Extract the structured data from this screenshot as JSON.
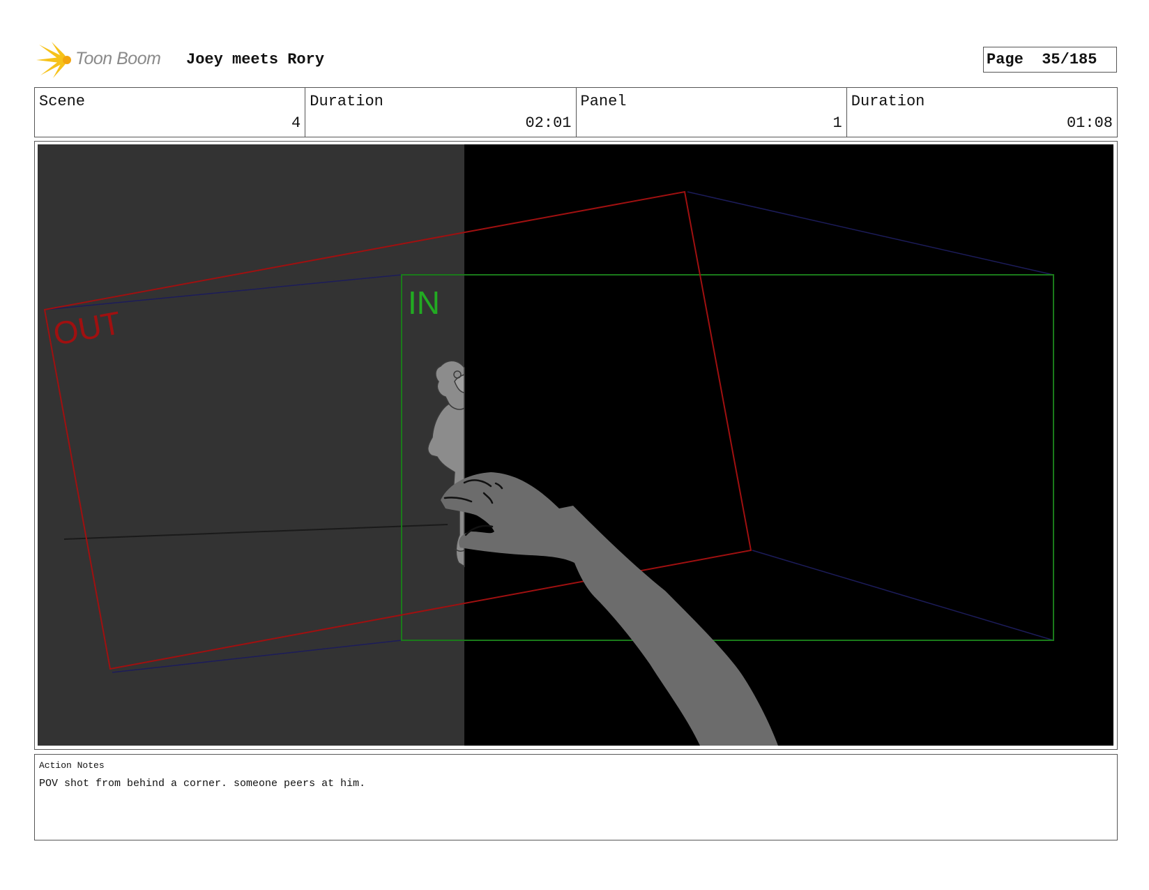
{
  "header": {
    "logo_text": "Toon Boom",
    "project_title": "Joey meets Rory",
    "page_label": "Page",
    "page_number": "35/185"
  },
  "info": [
    {
      "label": "Scene",
      "value": "4"
    },
    {
      "label": "Duration",
      "value": "02:01"
    },
    {
      "label": "Panel",
      "value": "1"
    },
    {
      "label": "Duration",
      "value": "01:08"
    }
  ],
  "panel": {
    "out_label": "OUT",
    "in_label": "IN",
    "colors": {
      "wall": "#333333",
      "background": "#000000",
      "out_frame": "#a01010",
      "in_frame": "#1a7a1a",
      "in_text": "#22aa22",
      "guide": "#1c1c5a",
      "figure": "#8a8a8a",
      "arm": "#6c6c6c"
    }
  },
  "notes": {
    "label": "Action Notes",
    "text": "POV shot from behind a corner. someone peers at him."
  }
}
